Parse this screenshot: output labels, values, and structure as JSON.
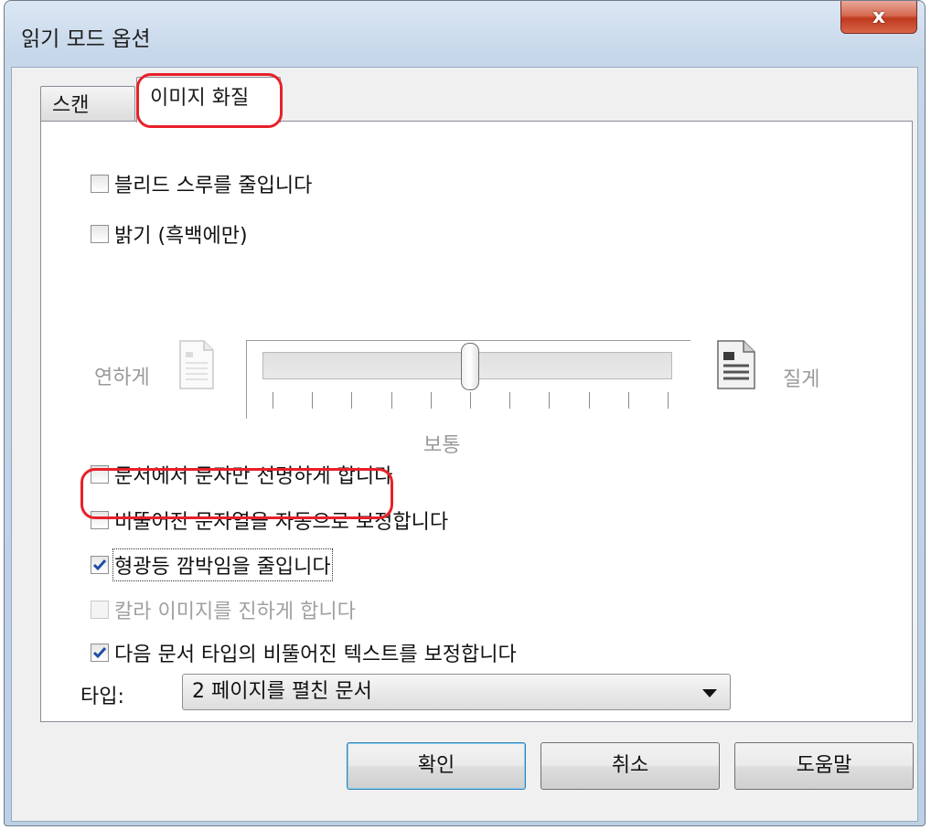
{
  "window": {
    "title": "읽기 모드 옵션",
    "close_label": "x"
  },
  "tabs": [
    {
      "label": "스캔",
      "selected": false
    },
    {
      "label": "이미지 화질",
      "selected": true
    }
  ],
  "options": [
    {
      "label": "블리드 스루를 줄입니다",
      "checked": false,
      "enabled": true
    },
    {
      "label": "밝기 (흑백에만)",
      "checked": false,
      "enabled": true
    },
    {
      "label": "문서에서 문자만 선명하게 합니다",
      "checked": false,
      "enabled": true
    },
    {
      "label": "비뚤어진 문자열을 자동으로 보정합니다",
      "checked": false,
      "enabled": true
    },
    {
      "label": "형광등 깜박임을 줄입니다",
      "checked": true,
      "enabled": true
    },
    {
      "label": "칼라 이미지를 진하게 합니다",
      "checked": false,
      "enabled": false
    },
    {
      "label": "다음 문서 타입의 비뚤어진 텍스트를 보정합니다",
      "checked": true,
      "enabled": true
    }
  ],
  "brightness_slider": {
    "left_label": "연하게",
    "right_label": "질게",
    "center_label": "보통",
    "tick_count": 11,
    "value_fraction": 0.5
  },
  "type_field": {
    "label": "타입:",
    "selected": "2 페이지를 펼친 문서"
  },
  "buttons": {
    "ok": "확인",
    "cancel": "취소",
    "help": "도움말"
  },
  "colors": {
    "highlight": "#e8202a",
    "checkmark": "#1f4ea8"
  },
  "icons": {
    "light_doc": "document-light-icon",
    "dark_doc": "document-dark-icon",
    "dropdown": "chevron-down-icon"
  }
}
